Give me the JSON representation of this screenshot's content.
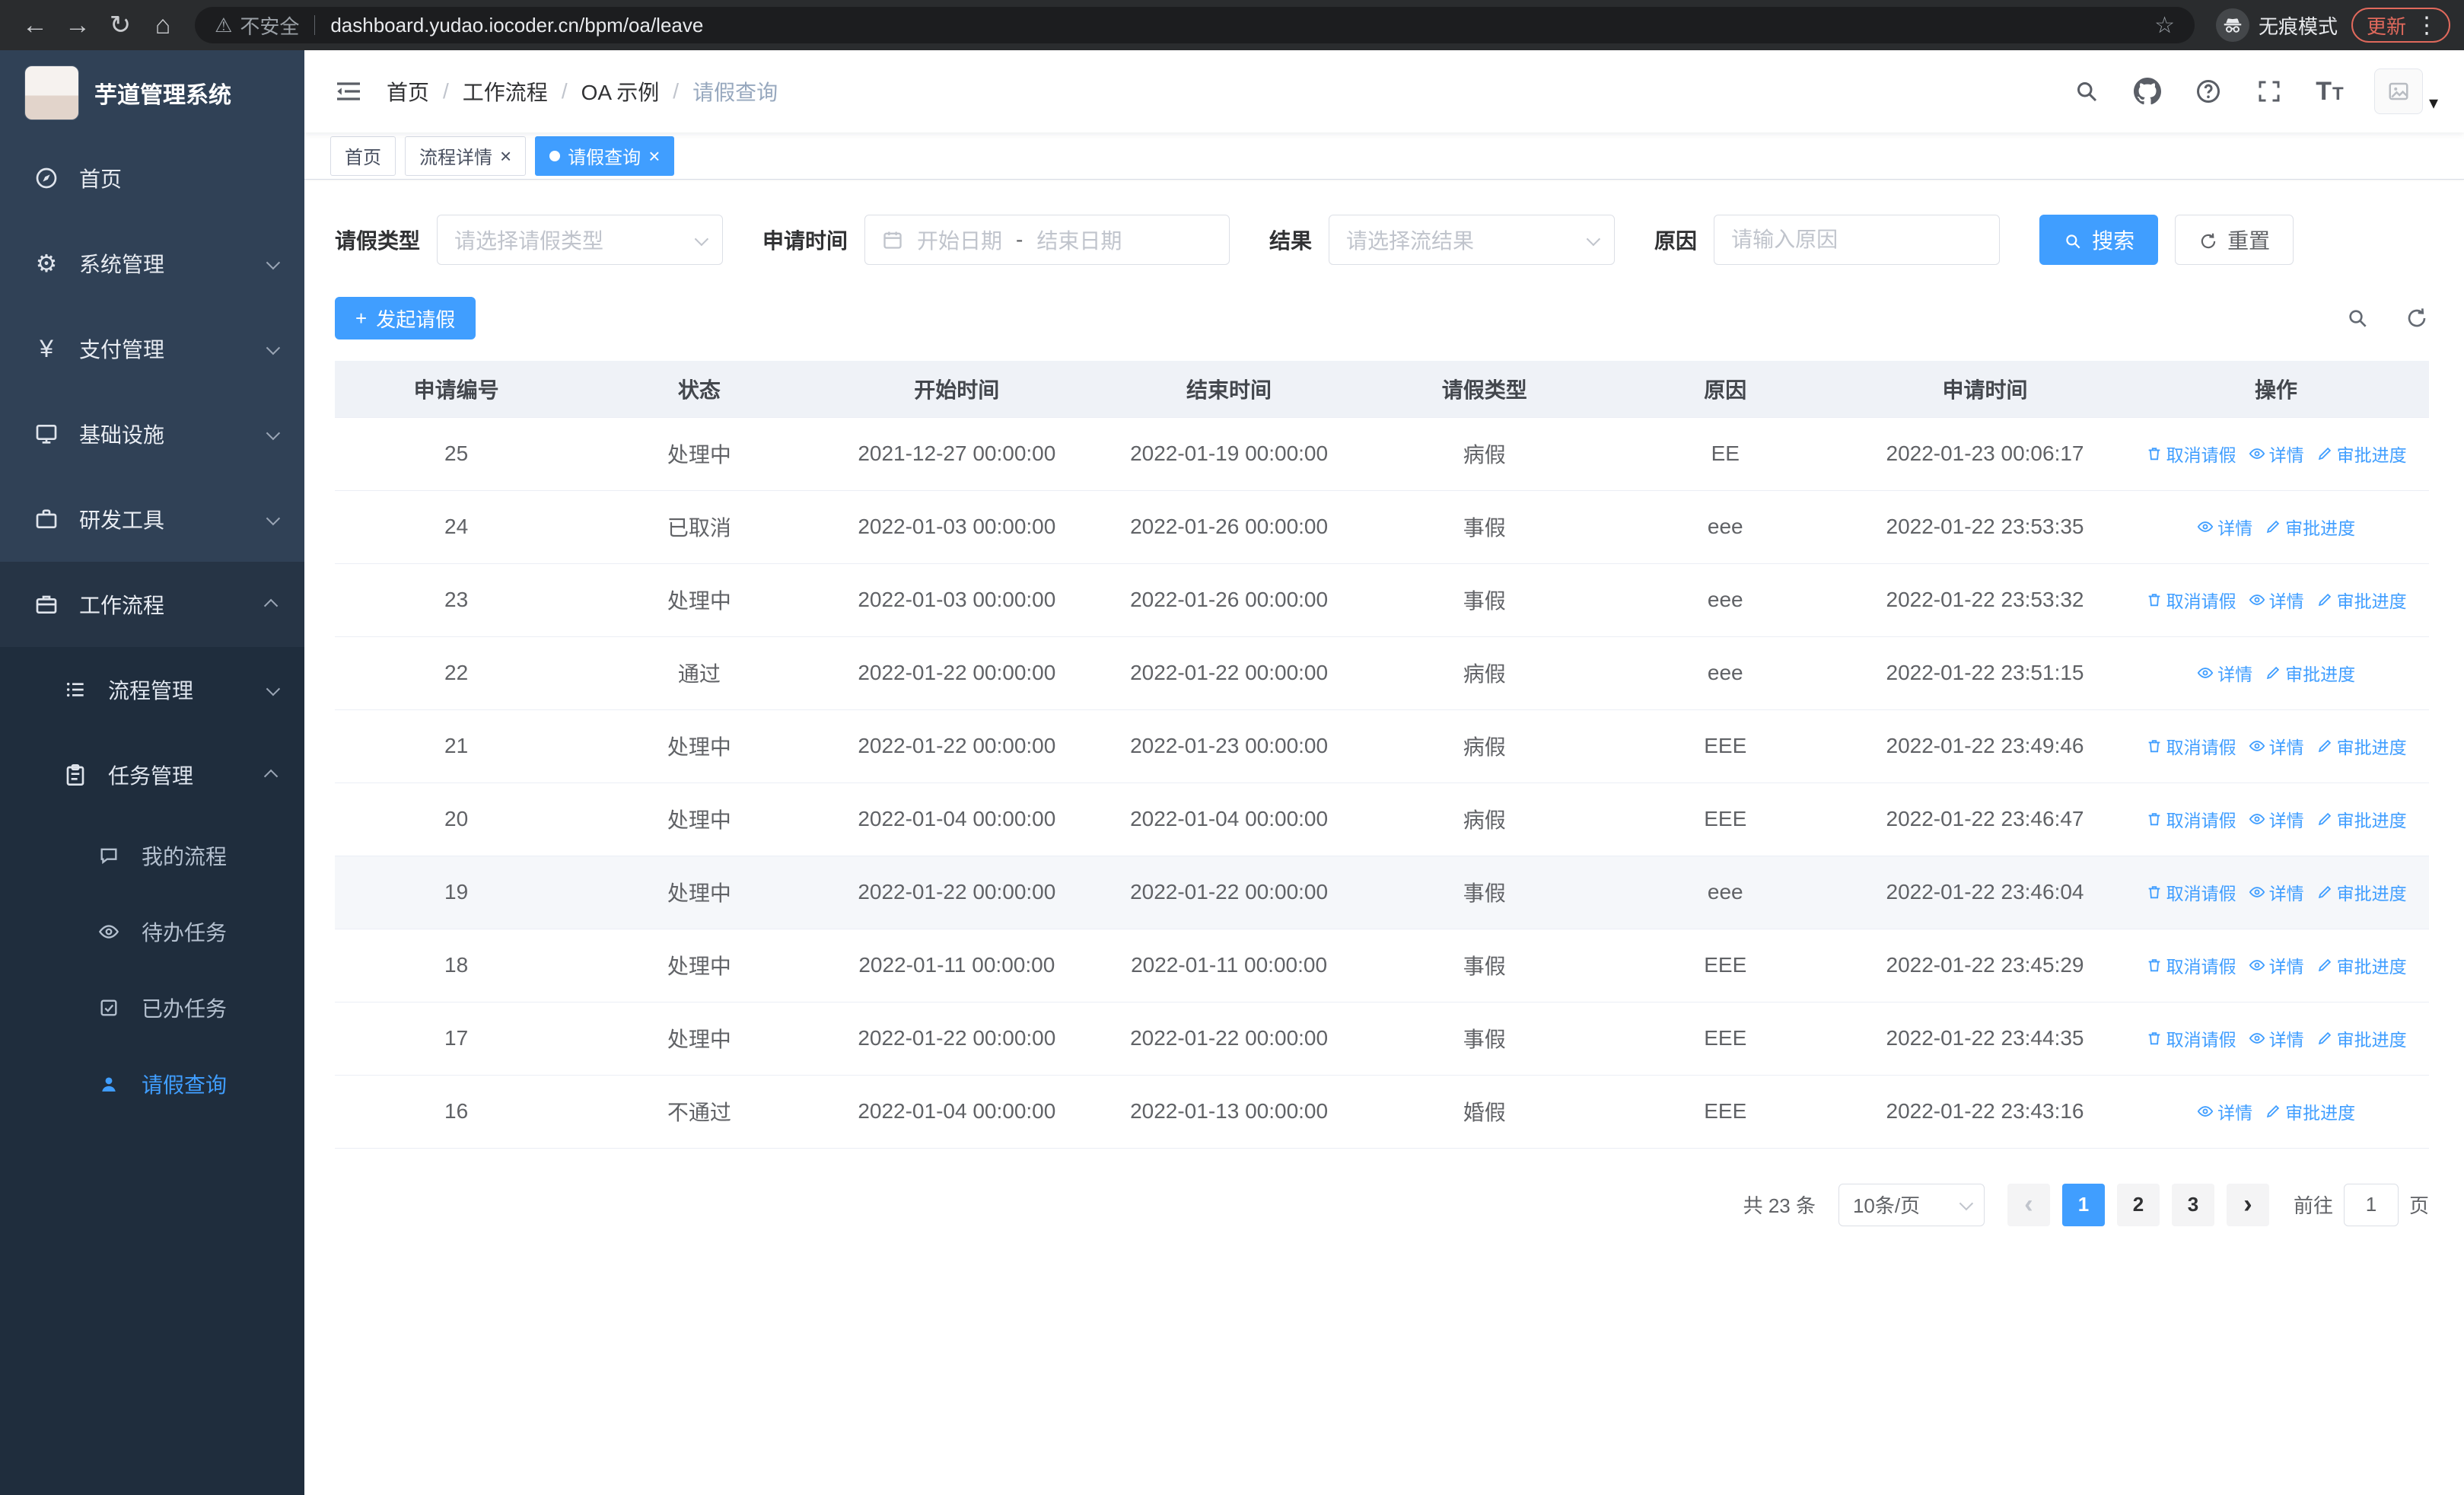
{
  "browser": {
    "security_label": "不安全",
    "url": "dashboard.yudao.iocoder.cn/bpm/oa/leave",
    "incognito_label": "无痕模式",
    "update_label": "更新"
  },
  "icons": {
    "back": "←",
    "forward": "→",
    "reload": "↻",
    "home": "⌂",
    "warning": "⚠",
    "star": "☆",
    "more": "⋮",
    "close": "×",
    "prev": "‹",
    "next": "›",
    "gear": "⚙",
    "yen": "¥",
    "caret": "▾",
    "plus": "+"
  },
  "sidebar": {
    "app_title": "芋道管理系统",
    "items": [
      {
        "label": "首页"
      },
      {
        "label": "系统管理"
      },
      {
        "label": "支付管理"
      },
      {
        "label": "基础设施"
      },
      {
        "label": "研发工具"
      },
      {
        "label": "工作流程"
      }
    ],
    "submenu": [
      {
        "label": "流程管理"
      },
      {
        "label": "任务管理"
      }
    ],
    "task_children": [
      {
        "label": "我的流程"
      },
      {
        "label": "待办任务"
      },
      {
        "label": "已办任务"
      },
      {
        "label": "请假查询"
      }
    ]
  },
  "header": {
    "separator": "/",
    "breadcrumb": [
      {
        "label": "首页"
      },
      {
        "label": "工作流程"
      },
      {
        "label": "OA 示例"
      },
      {
        "label": "请假查询"
      }
    ]
  },
  "tabs": [
    {
      "label": "首页"
    },
    {
      "label": "流程详情"
    },
    {
      "label": "请假查询"
    }
  ],
  "filters": {
    "leave_type_label": "请假类型",
    "leave_type_placeholder": "请选择请假类型",
    "apply_time_label": "申请时间",
    "start_date_placeholder": "开始日期",
    "range_separator": "-",
    "end_date_placeholder": "结束日期",
    "result_label": "结果",
    "result_placeholder": "请选择流结果",
    "reason_label": "原因",
    "reason_placeholder": "请输入原因",
    "search_label": "搜索",
    "reset_label": "重置"
  },
  "toolbar": {
    "create_label": "发起请假"
  },
  "table": {
    "columns": [
      {
        "label": "申请编号"
      },
      {
        "label": "状态"
      },
      {
        "label": "开始时间"
      },
      {
        "label": "结束时间"
      },
      {
        "label": "请假类型"
      },
      {
        "label": "原因"
      },
      {
        "label": "申请时间"
      },
      {
        "label": "操作"
      }
    ],
    "actions": {
      "cancel": "取消请假",
      "detail": "详情",
      "progress": "审批进度"
    },
    "rows": [
      {
        "id": "25",
        "status": "处理中",
        "start": "2021-12-27 00:00:00",
        "end": "2022-01-19 00:00:00",
        "type": "病假",
        "reason": "EE",
        "apply_time": "2022-01-23 00:06:17",
        "has_cancel": true
      },
      {
        "id": "24",
        "status": "已取消",
        "start": "2022-01-03 00:00:00",
        "end": "2022-01-26 00:00:00",
        "type": "事假",
        "reason": "eee",
        "apply_time": "2022-01-22 23:53:35",
        "has_cancel": false
      },
      {
        "id": "23",
        "status": "处理中",
        "start": "2022-01-03 00:00:00",
        "end": "2022-01-26 00:00:00",
        "type": "事假",
        "reason": "eee",
        "apply_time": "2022-01-22 23:53:32",
        "has_cancel": true
      },
      {
        "id": "22",
        "status": "通过",
        "start": "2022-01-22 00:00:00",
        "end": "2022-01-22 00:00:00",
        "type": "病假",
        "reason": "eee",
        "apply_time": "2022-01-22 23:51:15",
        "has_cancel": false
      },
      {
        "id": "21",
        "status": "处理中",
        "start": "2022-01-22 00:00:00",
        "end": "2022-01-23 00:00:00",
        "type": "病假",
        "reason": "EEE",
        "apply_time": "2022-01-22 23:49:46",
        "has_cancel": true
      },
      {
        "id": "20",
        "status": "处理中",
        "start": "2022-01-04 00:00:00",
        "end": "2022-01-04 00:00:00",
        "type": "病假",
        "reason": "EEE",
        "apply_time": "2022-01-22 23:46:47",
        "has_cancel": true
      },
      {
        "id": "19",
        "status": "处理中",
        "start": "2022-01-22 00:00:00",
        "end": "2022-01-22 00:00:00",
        "type": "事假",
        "reason": "eee",
        "apply_time": "2022-01-22 23:46:04",
        "has_cancel": true
      },
      {
        "id": "18",
        "status": "处理中",
        "start": "2022-01-11 00:00:00",
        "end": "2022-01-11 00:00:00",
        "type": "事假",
        "reason": "EEE",
        "apply_time": "2022-01-22 23:45:29",
        "has_cancel": true
      },
      {
        "id": "17",
        "status": "处理中",
        "start": "2022-01-22 00:00:00",
        "end": "2022-01-22 00:00:00",
        "type": "事假",
        "reason": "EEE",
        "apply_time": "2022-01-22 23:44:35",
        "has_cancel": true
      },
      {
        "id": "16",
        "status": "不通过",
        "start": "2022-01-04 00:00:00",
        "end": "2022-01-13 00:00:00",
        "type": "婚假",
        "reason": "EEE",
        "apply_time": "2022-01-22 23:43:16",
        "has_cancel": false
      }
    ]
  },
  "pagination": {
    "total_label": "共 23 条",
    "page_size_label": "10条/页",
    "pages": [
      {
        "label": "1"
      },
      {
        "label": "2"
      },
      {
        "label": "3"
      }
    ],
    "goto_label": "前往",
    "goto_value": "1",
    "goto_suffix_label": "页"
  }
}
